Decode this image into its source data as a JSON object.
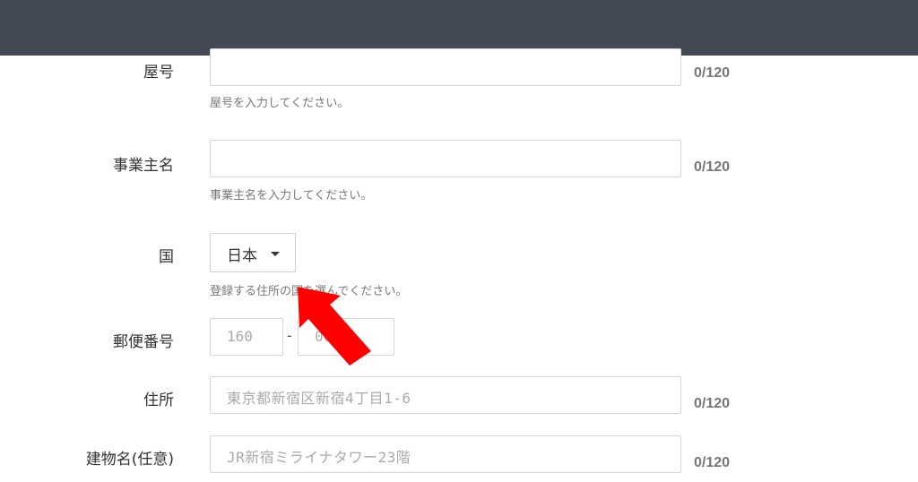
{
  "form": {
    "shop_name": {
      "label": "屋号",
      "value": "",
      "counter": "0/120",
      "help": "屋号を入力してください。"
    },
    "owner_name": {
      "label": "事業主名",
      "value": "",
      "counter": "0/120",
      "help": "事業主名を入力してください。"
    },
    "country": {
      "label": "国",
      "selected": "日本",
      "help": "登録する住所の国を選んでください。"
    },
    "postal_code": {
      "label": "郵便番号",
      "part1_placeholder": "160",
      "separator": "-",
      "part2_placeholder": "0023"
    },
    "address": {
      "label": "住所",
      "placeholder": "東京都新宿区新宿4丁目1-6",
      "counter": "0/120"
    },
    "building": {
      "label": "建物名(任意)",
      "placeholder": "JR新宿ミライナタワー23階",
      "counter": "0/120"
    }
  },
  "colors": {
    "header": "#434a55",
    "arrow": "#ff0000"
  },
  "icons": {
    "dropdown": "caret-down-icon",
    "pointer": "red-arrow-icon"
  }
}
